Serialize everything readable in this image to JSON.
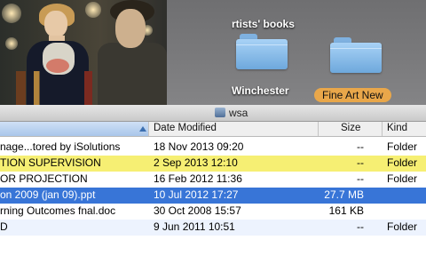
{
  "desktop": {
    "labels": {
      "artists_books": "rtists' books",
      "winchester": "Winchester",
      "fine_art_new": "Fine Art New"
    },
    "pill_color": "#e9a74a"
  },
  "window": {
    "title": "wsa",
    "columns": {
      "date_modified": "Date Modified",
      "size": "Size",
      "kind": "Kind"
    },
    "rows": [
      {
        "name": "nage...tored by iSolutions",
        "date": "18 Nov 2013 09:20",
        "size": "--",
        "kind": "Folder",
        "style": "normal"
      },
      {
        "name": "TION SUPERVISION",
        "date": "2 Sep 2013 12:10",
        "size": "--",
        "kind": "Folder",
        "style": "yellow"
      },
      {
        "name": "OR PROJECTION",
        "date": "16 Feb 2012 11:36",
        "size": "--",
        "kind": "Folder",
        "style": "normal"
      },
      {
        "name": "on 2009 (jan 09).ppt",
        "date": "10 Jul 2012 17:27",
        "size": "27.7 MB",
        "kind": "",
        "style": "selected"
      },
      {
        "name": "rning Outcomes fnal.doc",
        "date": "30 Oct 2008 15:57",
        "size": "161 KB",
        "kind": "",
        "style": "normal"
      },
      {
        "name": "D",
        "date": "9 Jun 2011 10:51",
        "size": "--",
        "kind": "Folder",
        "style": "alt"
      }
    ]
  },
  "colors": {
    "selection": "#3875d7",
    "highlight_yellow": "#f6ef73",
    "folder_blue": "#8cc2f0"
  }
}
